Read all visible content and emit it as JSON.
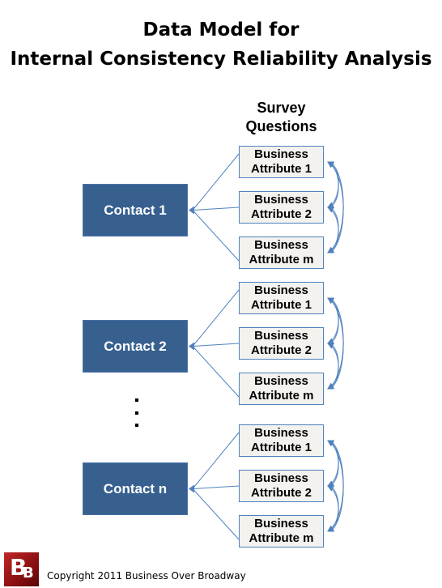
{
  "title": {
    "line1": "Data Model for",
    "line2": "Internal Consistency Reliability Analysis"
  },
  "column_header": {
    "line1": "Survey",
    "line2": "Questions"
  },
  "contacts": [
    {
      "label": "Contact 1",
      "attributes": [
        {
          "line1": "Business",
          "line2": "Attribute 1"
        },
        {
          "line1": "Business",
          "line2": "Attribute 2"
        },
        {
          "line1": "Business",
          "line2": "Attribute m"
        }
      ]
    },
    {
      "label": "Contact 2",
      "attributes": [
        {
          "line1": "Business",
          "line2": "Attribute 1"
        },
        {
          "line1": "Business",
          "line2": "Attribute 2"
        },
        {
          "line1": "Business",
          "line2": "Attribute m"
        }
      ]
    },
    {
      "label": "Contact n",
      "attributes": [
        {
          "line1": "Business",
          "line2": "Attribute 1"
        },
        {
          "line1": "Business",
          "line2": "Attribute 2"
        },
        {
          "line1": "Business",
          "line2": "Attribute m"
        }
      ]
    }
  ],
  "ellipsis": "...",
  "colors": {
    "contact_fill": "#37608f",
    "attribute_fill": "#f4f2ee",
    "connector": "#4f81bd",
    "logo": "#8e1112"
  },
  "footer": {
    "logo_text_big": "B",
    "logo_text_small": "B",
    "copyright": "Copyright 2011 Business Over Broadway"
  }
}
